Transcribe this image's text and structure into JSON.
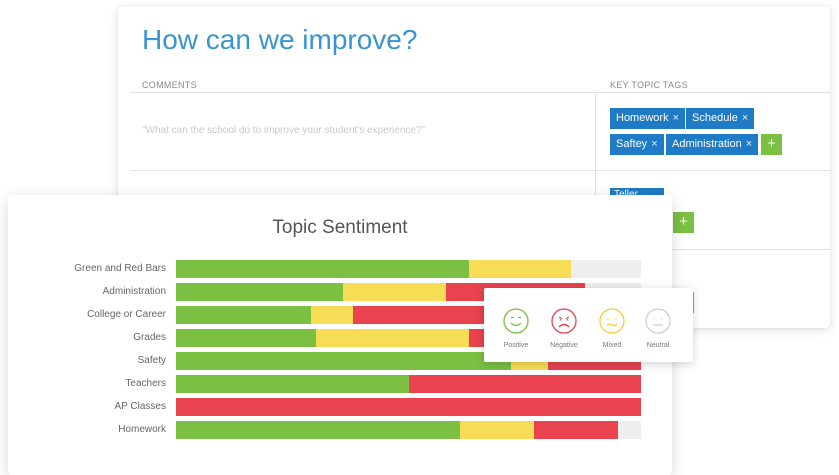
{
  "survey": {
    "title": "How can we improve?",
    "comments_header": "COMMENTS",
    "tags_header": "KEY TOPIC TAGS",
    "comment_placeholder": "\"What can the school do to improve your student's experience?\"",
    "tags": [
      {
        "label": "Homework"
      },
      {
        "label": "Schedule"
      },
      {
        "label": "Saftey"
      },
      {
        "label": "Administration"
      }
    ],
    "partial_tag": "Teller",
    "remove_glyph": "×",
    "add_glyph": "+"
  },
  "sentiment": {
    "legend": [
      {
        "label": "Positive",
        "color": "#7bbf43",
        "icon": "happy-face-icon"
      },
      {
        "label": "Negative",
        "color": "#e8434e",
        "icon": "sad-face-icon"
      },
      {
        "label": "Mixed",
        "color": "#f7dd56",
        "icon": "confused-face-icon"
      },
      {
        "label": "Neutral",
        "color": "#d6d6d6",
        "icon": "neutral-face-icon"
      }
    ]
  },
  "chart_data": {
    "type": "bar",
    "orientation": "horizontal",
    "stacked": true,
    "title": "Topic Sentiment",
    "categories": [
      "Green and Red Bars",
      "Administration",
      "College or Career",
      "Grades",
      "Safety",
      "Teachers",
      "AP Classes",
      "Homework"
    ],
    "series": [
      {
        "name": "Positive",
        "color": "#7bbf43",
        "values": [
          63,
          36,
          29,
          30,
          72,
          50,
          0,
          61
        ]
      },
      {
        "name": "Mixed",
        "color": "#f7dd56",
        "values": [
          22,
          22,
          9,
          33,
          8,
          0,
          0,
          16
        ]
      },
      {
        "name": "Negative",
        "color": "#e8434e",
        "values": [
          0,
          30,
          62,
          37,
          20,
          50,
          100,
          18
        ]
      },
      {
        "name": "Neutral",
        "color": "#eeeeee",
        "values": [
          15,
          12,
          0,
          0,
          0,
          0,
          0,
          5
        ]
      }
    ],
    "xlim": [
      0,
      100
    ]
  }
}
